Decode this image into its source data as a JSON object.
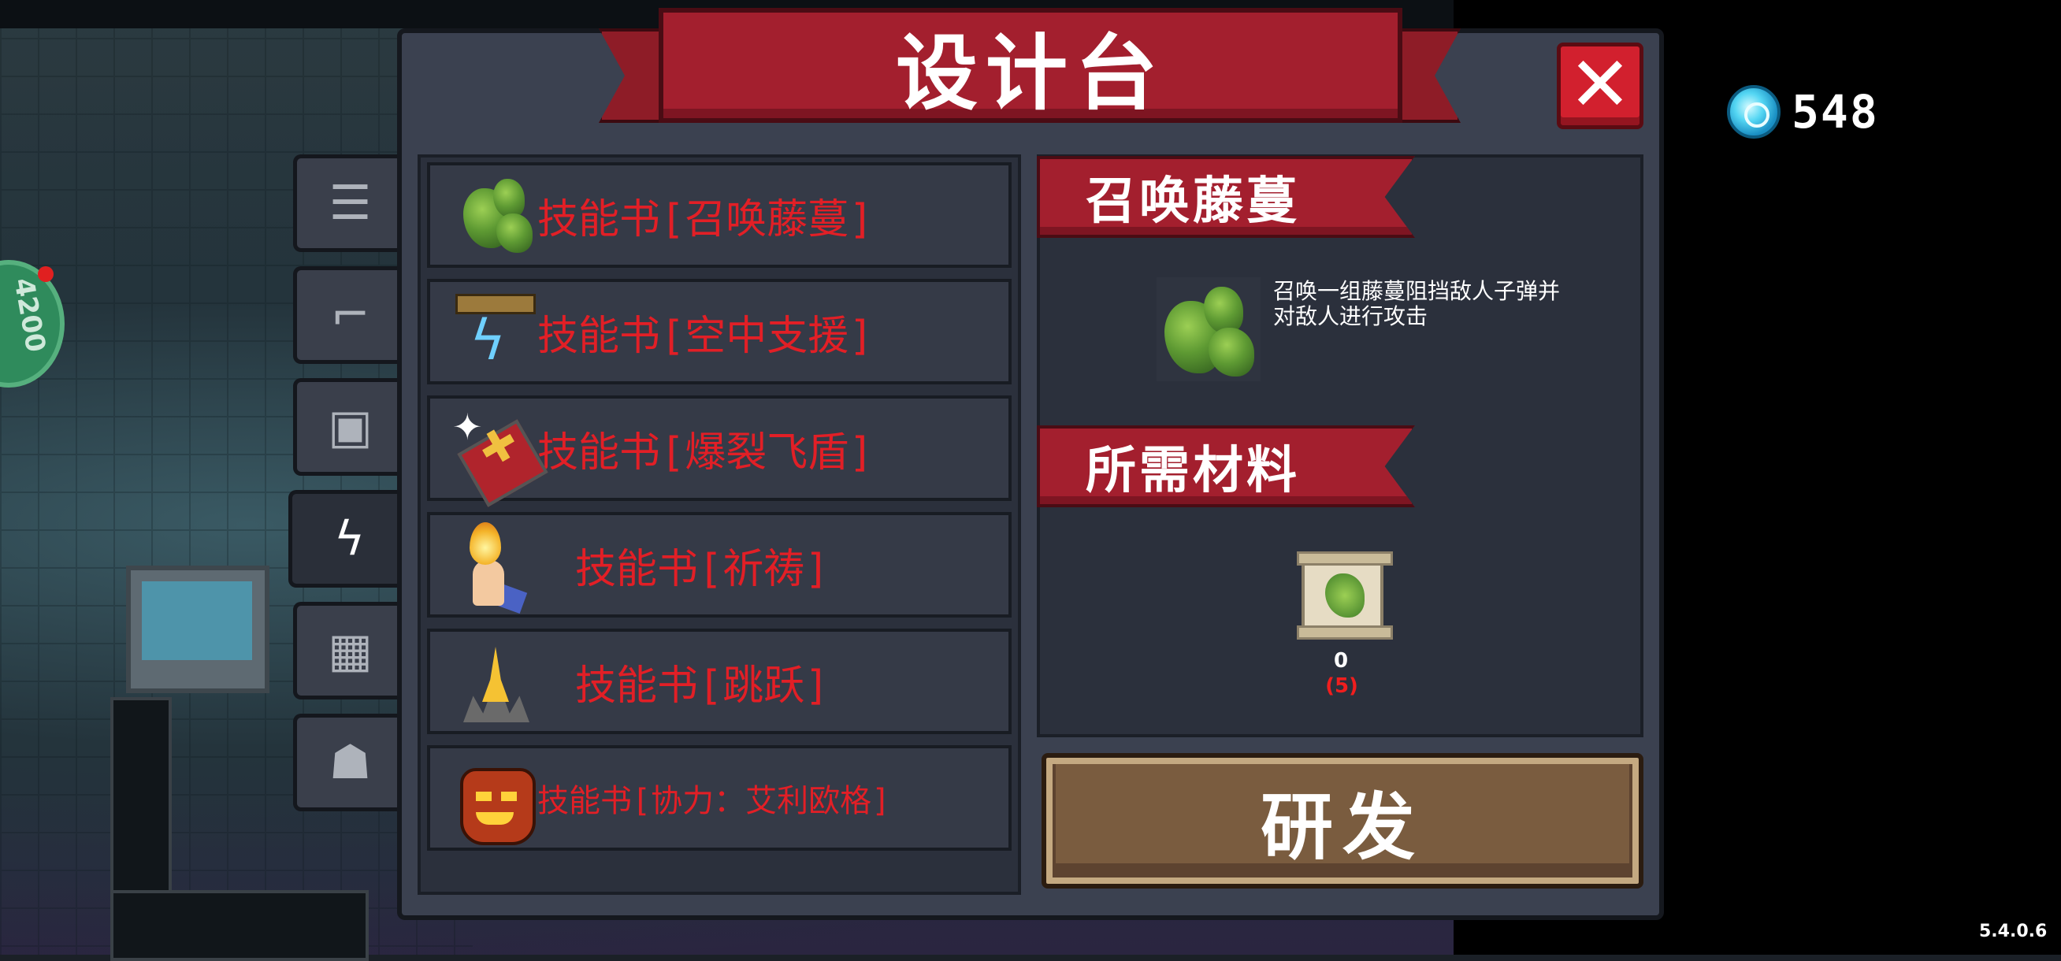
{
  "header": {
    "title": "设计台"
  },
  "currency": {
    "value": "548",
    "icon": "gem-icon"
  },
  "version": "5.4.0.6",
  "hud": {
    "hp_text": "4200"
  },
  "tabs": [
    {
      "icon": "list-icon",
      "glyph": "☰"
    },
    {
      "icon": "gun-icon",
      "glyph": "⌐"
    },
    {
      "icon": "armor-icon",
      "glyph": "▣"
    },
    {
      "icon": "lightning-icon",
      "glyph": "ϟ"
    },
    {
      "icon": "parts-icon",
      "glyph": "▦"
    },
    {
      "icon": "pet-icon",
      "glyph": "☗"
    }
  ],
  "items": [
    {
      "label": "技能书[召唤藤蔓]",
      "icon": "vine-icon"
    },
    {
      "label": "技能书[空中支援]",
      "icon": "air-support-icon"
    },
    {
      "label": "技能书[爆裂飞盾]",
      "icon": "flying-shield-icon"
    },
    {
      "label": "技能书[祈祷]",
      "icon": "pray-icon"
    },
    {
      "label": "技能书[跳跃]",
      "icon": "jump-icon"
    },
    {
      "label": "技能书[协力：艾利欧格]",
      "icon": "mask-icon"
    }
  ],
  "detail": {
    "title": "召唤藤蔓",
    "description": "召唤一组藤蔓阻挡敌人子弹并对敌人进行攻击",
    "materials_title": "所需材料",
    "material": {
      "have": "0",
      "need": "(5)",
      "icon": "vine-scroll-icon"
    }
  },
  "buttons": {
    "research": "研发",
    "close": "✕"
  },
  "colors": {
    "accent_red": "#a31f2e",
    "label_red": "#e21f26",
    "panel": "#3b4150",
    "button_brown": "#7a5c3f"
  }
}
